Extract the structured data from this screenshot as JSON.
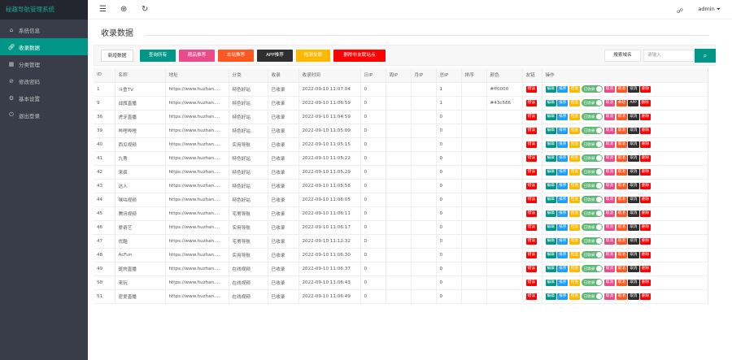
{
  "app": {
    "title": "秘趣导航管理系统"
  },
  "sidebar": {
    "items": [
      {
        "label": "系统信息",
        "icon": "home-icon",
        "active": false
      },
      {
        "label": "收录数据",
        "icon": "link-icon",
        "active": true
      },
      {
        "label": "分类管理",
        "icon": "category-icon",
        "active": false
      },
      {
        "label": "修改密码",
        "icon": "password-icon",
        "active": false
      },
      {
        "label": "基本设置",
        "icon": "settings-icon",
        "active": false
      },
      {
        "label": "退出登录",
        "icon": "logout-icon",
        "active": false
      }
    ]
  },
  "topbar": {
    "user": "admin ⏷"
  },
  "page": {
    "title": "收录数据"
  },
  "toolbar": {
    "buttons": [
      {
        "label": "新增数据",
        "bg": "#ffffff",
        "color": "#333333"
      },
      {
        "label": "查询所有",
        "bg": "#009688",
        "color": "#ffffff"
      },
      {
        "label": "精品推荐",
        "bg": "#ea4c89",
        "color": "#ffffff"
      },
      {
        "label": "本站推荐",
        "bg": "#ff5722",
        "color": "#ffffff"
      },
      {
        "label": "APP推荐",
        "bg": "#2f2f2f",
        "color": "#ffffff"
      },
      {
        "label": "检测友联",
        "bg": "#ffb800",
        "color": "#ffffff"
      },
      {
        "label": "删除非友联站点",
        "bg": "#ff0000",
        "color": "#ffffff"
      }
    ],
    "search_label": "搜索域名",
    "search_placeholder": "请输入"
  },
  "table": {
    "headers": [
      "ID",
      "名称",
      "地址",
      "分类",
      "收录",
      "收录时间",
      "日IP",
      "周IP",
      "月IP",
      "总IP",
      "排序",
      "颜色",
      "友链",
      "操作"
    ],
    "rows": [
      [
        "1",
        "斗鱼TV",
        "https://www.huzhan....",
        "特色好站",
        "已收录",
        "2022-09-10 11:07:04",
        "0",
        "",
        "",
        "1",
        "",
        "#ff0000",
        "错误"
      ],
      [
        "9",
        "战旗直播",
        "https://www.huzhan....",
        "特色好站",
        "已收录",
        "2022-09-10 11:06:59",
        "0",
        "",
        "",
        "1",
        "",
        "#43c586",
        "错误"
      ],
      [
        "36",
        "虎牙直播",
        "https://www.huzhan....",
        "特色好站",
        "已收录",
        "2022-09-10 11:04:59",
        "0",
        "",
        "",
        "0",
        "",
        "",
        "错误"
      ],
      [
        "39",
        "哔哩哔哩",
        "https://www.huzhan....",
        "特色好站",
        "已收录",
        "2022-09-10 11:05:09",
        "0",
        "",
        "",
        "0",
        "",
        "",
        "错误"
      ],
      [
        "40",
        "西瓜视频",
        "https://www.huzhan....",
        "实用导航",
        "已收录",
        "2022-09-10 11:05:15",
        "0",
        "",
        "",
        "0",
        "",
        "",
        "错误"
      ],
      [
        "41",
        "九秀",
        "https://www.huzhan....",
        "特色好站",
        "已收录",
        "2022-09-10 11:05:22",
        "0",
        "",
        "",
        "0",
        "",
        "",
        "错误"
      ],
      [
        "42",
        "来疯",
        "https://www.huzhan....",
        "特色好站",
        "已收录",
        "2022-09-10 11:05:29",
        "0",
        "",
        "",
        "0",
        "",
        "",
        "错误"
      ],
      [
        "43",
        "达人",
        "https://www.huzhan....",
        "特色好站",
        "已收录",
        "2022-09-10 11:05:58",
        "0",
        "",
        "",
        "0",
        "",
        "",
        "错误"
      ],
      [
        "44",
        "咪咕视频",
        "https://www.huzhan....",
        "特色好站",
        "已收录",
        "2022-09-10 11:06:05",
        "0",
        "",
        "",
        "0",
        "",
        "",
        "错误"
      ],
      [
        "45",
        "腾讯视频",
        "https://www.huzhan....",
        "宅男导航",
        "已收录",
        "2022-09-10 11:06:11",
        "0",
        "",
        "",
        "0",
        "",
        "",
        "错误"
      ],
      [
        "46",
        "爱奇艺",
        "https://www.huzhan....",
        "实用导航",
        "已收录",
        "2022-09-10 11:06:17",
        "0",
        "",
        "",
        "0",
        "",
        "",
        "错误"
      ],
      [
        "47",
        "优酷",
        "https://www.huzhan....",
        "宅男导航",
        "已收录",
        "2022-09-10 11:12:32",
        "0",
        "",
        "",
        "0",
        "",
        "",
        "错误"
      ],
      [
        "48",
        "AcFun",
        "https://www.huzhan....",
        "实用导航",
        "已收录",
        "2022-09-10 11:06:30",
        "0",
        "",
        "",
        "0",
        "",
        "",
        "错误"
      ],
      [
        "49",
        "斑肉直播",
        "https://www.huzhan....",
        "在线视频",
        "已收录",
        "2022-09-10 11:06:37",
        "0",
        "",
        "",
        "0",
        "",
        "",
        "错误"
      ],
      [
        "50",
        "来玩",
        "https://www.huzhan....",
        "在线视频",
        "已收录",
        "2022-09-10 11:06:43",
        "0",
        "",
        "",
        "0",
        "",
        "",
        "错误"
      ],
      [
        "51",
        "密爱直播",
        "https://www.huzhan....",
        "在线视频",
        "已收录",
        "2022-09-10 11:06:49",
        "0",
        "",
        "",
        "0",
        "",
        "",
        "错误"
      ]
    ]
  },
  "actions": [
    {
      "label": "编辑",
      "bg": "#009688"
    },
    {
      "label": "排序",
      "bg": "#1e9fff"
    },
    {
      "label": "检查",
      "bg": "#ffb800"
    },
    {
      "label": "已收录",
      "bg": "#5fb878",
      "toggle": true
    },
    {
      "label": "取消",
      "bg": "#ea4c89"
    },
    {
      "label": "取消",
      "bg": "#ff5722"
    },
    {
      "label": "取消",
      "bg": "#2f2f2f"
    },
    {
      "label": "删除",
      "bg": "#ff0000"
    }
  ],
  "row_overrides": {
    "1": {
      "5": "本站",
      "6": "APP"
    }
  }
}
